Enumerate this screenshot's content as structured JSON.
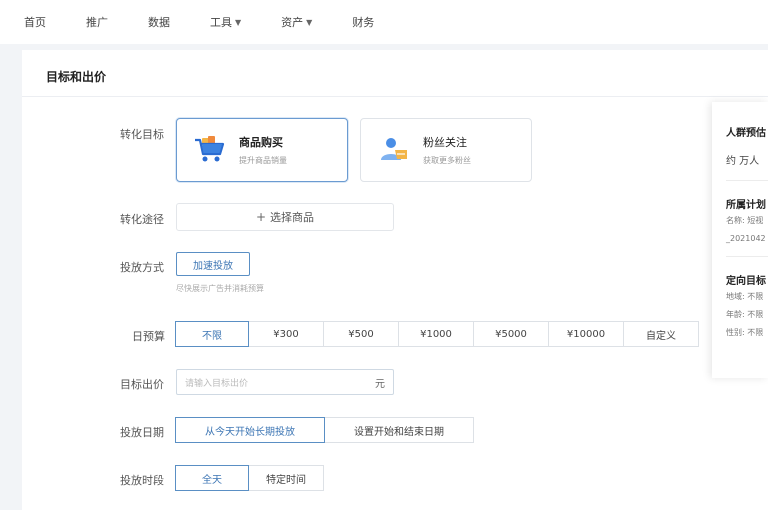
{
  "nav": {
    "items": [
      {
        "label": "首页",
        "dropdown": false
      },
      {
        "label": "推广",
        "dropdown": false
      },
      {
        "label": "数据",
        "dropdown": false
      },
      {
        "label": "工具",
        "dropdown": true
      },
      {
        "label": "资产",
        "dropdown": true
      },
      {
        "label": "财务",
        "dropdown": false
      }
    ]
  },
  "section": {
    "title": "目标和出价"
  },
  "goal": {
    "label": "转化目标",
    "options": [
      {
        "title": "商品购买",
        "sub": "提升商品销量",
        "icon": "shopping-cart-icon",
        "selected": true
      },
      {
        "title": "粉丝关注",
        "sub": "获取更多粉丝",
        "icon": "user-follow-icon",
        "selected": false
      }
    ]
  },
  "path": {
    "label": "转化途径",
    "button": "选择商品",
    "icon": "plus-icon"
  },
  "method": {
    "label": "投放方式",
    "button": "加速投放",
    "hint": "尽快展示广告并消耗预算"
  },
  "budget": {
    "label": "日预算",
    "options": [
      "不限",
      "¥300",
      "¥500",
      "¥1000",
      "¥5000",
      "¥10000",
      "自定义"
    ],
    "selected": 0
  },
  "bid": {
    "label": "目标出价",
    "placeholder": "请输入目标出价",
    "unit": "元"
  },
  "date": {
    "label": "投放日期",
    "options": [
      "从今天开始长期投放",
      "设置开始和结束日期"
    ],
    "selected": 0
  },
  "time": {
    "label": "投放时段",
    "options": [
      "全天",
      "特定时间"
    ],
    "selected": 0
  },
  "panel": {
    "crowd_title": "人群预估",
    "crowd_value": "约 万人",
    "plan_title": "所属计划",
    "plan_name_prefix": "名称",
    "plan_name_value": "短视",
    "plan_date": "_2021042",
    "target_title": "定向目标",
    "region_label": "地域",
    "region_value": "不限",
    "age_label": "年龄",
    "age_value": "不限",
    "gender_label": "性别",
    "gender_value": "不限"
  },
  "colors": {
    "accent": "#3d76b4",
    "accent_border": "#5a8fc4",
    "page_bg": "#f2f4f7"
  }
}
